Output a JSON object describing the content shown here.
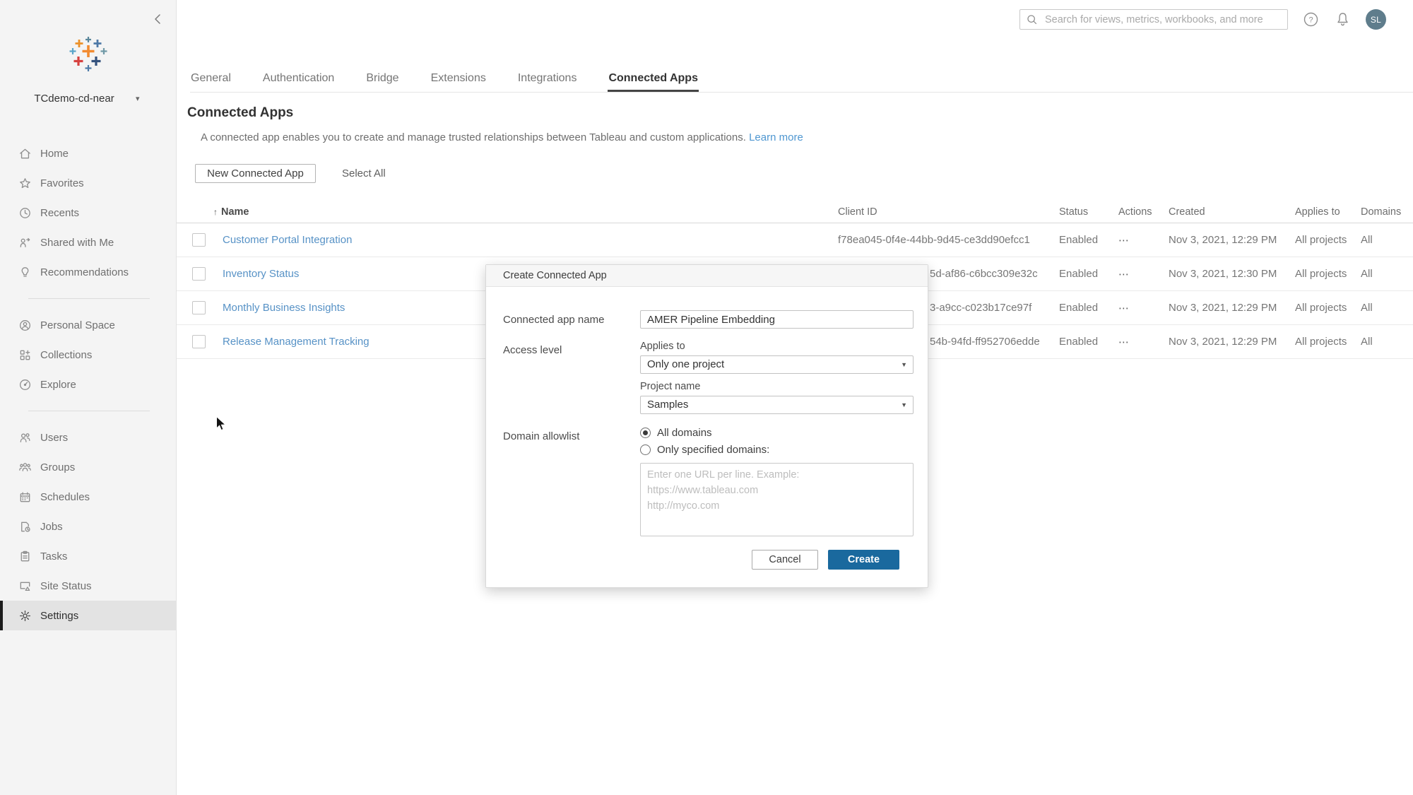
{
  "colors": {
    "accent_blue": "#1a699e",
    "link_blue": "#5792c6",
    "learn_more_blue": "#4f97d1",
    "avatar_bg": "#5f7d8c",
    "sidebar_bg": "#f4f4f4",
    "selected_item_bg": "#e3e3e3"
  },
  "icons": {
    "collapse_chevron": "collapse-left",
    "site_caret": "▾",
    "dropdown_caret": "▼",
    "sort_ascending": "↑",
    "actions_ellipsis": "⋯",
    "help": "?"
  },
  "sidebar": {
    "site_name": "TCdemo-cd-near",
    "items": [
      {
        "label": "Home"
      },
      {
        "label": "Favorites"
      },
      {
        "label": "Recents"
      },
      {
        "label": "Shared with Me"
      },
      {
        "label": "Recommendations"
      },
      {
        "label": "Personal Space"
      },
      {
        "label": "Collections"
      },
      {
        "label": "Explore"
      },
      {
        "label": "Users"
      },
      {
        "label": "Groups"
      },
      {
        "label": "Schedules"
      },
      {
        "label": "Jobs"
      },
      {
        "label": "Tasks"
      },
      {
        "label": "Site Status"
      },
      {
        "label": "Settings"
      }
    ]
  },
  "header": {
    "search_placeholder": "Search for views, metrics, workbooks, and more",
    "avatar_initials": "SL"
  },
  "tabs": [
    {
      "label": "General"
    },
    {
      "label": "Authentication"
    },
    {
      "label": "Bridge"
    },
    {
      "label": "Extensions"
    },
    {
      "label": "Integrations"
    },
    {
      "label": "Connected Apps"
    }
  ],
  "page": {
    "title": "Connected Apps",
    "description": "A connected app enables you to create and manage trusted relationships between Tableau and custom applications.",
    "learn_more_label": "Learn more",
    "new_connected_app_label": "New Connected App",
    "select_all_label": "Select All"
  },
  "table": {
    "columns": [
      "Name",
      "Client ID",
      "Status",
      "Actions",
      "Created",
      "Applies to",
      "Domains"
    ],
    "rows": [
      {
        "name": "Customer Portal Integration",
        "client_id": "f78ea045-0f4e-44bb-9d45-ce3dd90efcc1",
        "status": "Enabled",
        "created": "Nov 3, 2021, 12:29 PM",
        "applies_to": "All projects",
        "domains": "All"
      },
      {
        "name": "Inventory Status",
        "client_id": "5d-af86-c6bcc309e32c",
        "status": "Enabled",
        "created": "Nov 3, 2021, 12:30 PM",
        "applies_to": "All projects",
        "domains": "All"
      },
      {
        "name": "Monthly Business Insights",
        "client_id": "3-a9cc-c023b17ce97f",
        "status": "Enabled",
        "created": "Nov 3, 2021, 12:29 PM",
        "applies_to": "All projects",
        "domains": "All"
      },
      {
        "name": "Release Management Tracking",
        "client_id": "54b-94fd-ff952706edde",
        "status": "Enabled",
        "created": "Nov 3, 2021, 12:29 PM",
        "applies_to": "All projects",
        "domains": "All"
      }
    ]
  },
  "modal": {
    "title": "Create Connected App",
    "name_label": "Connected app name",
    "name_value": "AMER Pipeline Embedding",
    "access_label": "Access level",
    "applies_to_label": "Applies to",
    "applies_to_value": "Only one project",
    "project_name_label": "Project name",
    "project_name_value": "Samples",
    "domain_label": "Domain allowlist",
    "radio_all_domains": "All domains",
    "radio_specified_domains": "Only specified domains:",
    "all_domains_selected": true,
    "domains_placeholder": "Enter one URL per line. Example:\nhttps://www.tableau.com\nhttp://myco.com",
    "cancel_label": "Cancel",
    "create_label": "Create"
  }
}
